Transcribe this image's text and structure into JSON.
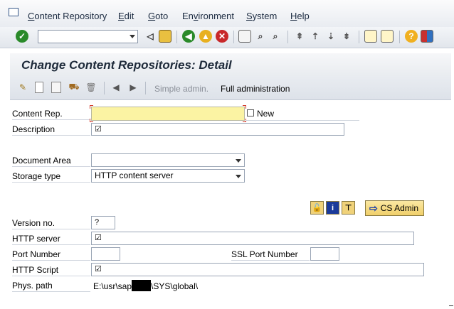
{
  "menu": {
    "items": [
      {
        "pre": "",
        "ul": "C",
        "post": "ontent Repository"
      },
      {
        "pre": "",
        "ul": "E",
        "post": "dit"
      },
      {
        "pre": "",
        "ul": "G",
        "post": "oto"
      },
      {
        "pre": "En",
        "ul": "v",
        "post": "ironment"
      },
      {
        "pre": "",
        "ul": "S",
        "post": "ystem"
      },
      {
        "pre": "",
        "ul": "H",
        "post": "elp"
      }
    ]
  },
  "toolbar": {
    "command_value": "",
    "icons": [
      "enter-icon",
      "back-triangle-icon",
      "save-icon",
      "back-icon",
      "exit-icon",
      "cancel-icon",
      "print-icon",
      "find-icon",
      "find-next-icon",
      "first-page-icon",
      "previous-page-icon",
      "next-page-icon",
      "last-page-icon",
      "create-session-icon",
      "shortcut-icon",
      "help-icon",
      "layout-menu-icon"
    ]
  },
  "title": "Change Content Repositories: Detail",
  "app_toolbar": {
    "icons": [
      "display-change-icon",
      "new-entry-icon",
      "copy-icon",
      "transport-icon",
      "delete-icon",
      "previous-icon",
      "next-icon"
    ],
    "simple_admin": "Simple admin.",
    "full_admin": "Full administration"
  },
  "form": {
    "content_rep": {
      "label": "Content Rep.",
      "value": "",
      "new_label": "New"
    },
    "description": {
      "label": "Description",
      "value": "☑"
    },
    "document_area": {
      "label": "Document Area",
      "value": ""
    },
    "storage_type": {
      "label": "Storage type",
      "value": "HTTP content server"
    },
    "version_no": {
      "label": "Version no.",
      "value": "?"
    },
    "http_server": {
      "label": "HTTP server",
      "value": "☑"
    },
    "port_number": {
      "label": "Port Number",
      "value": ""
    },
    "ssl_port_number": {
      "label": "SSL Port Number",
      "value": ""
    },
    "http_script": {
      "label": "HTTP Script",
      "value": "☑"
    },
    "phys_path": {
      "label": "Phys. path",
      "value_prefix": "E:\\usr\\sap",
      "value_suffix": "\\SYS\\global\\"
    }
  },
  "cs_admin_label": "CS Admin",
  "colors": {
    "required_field": "#fbf3a3",
    "accent": "#1a3fa8",
    "button": "#f0cf6a"
  }
}
